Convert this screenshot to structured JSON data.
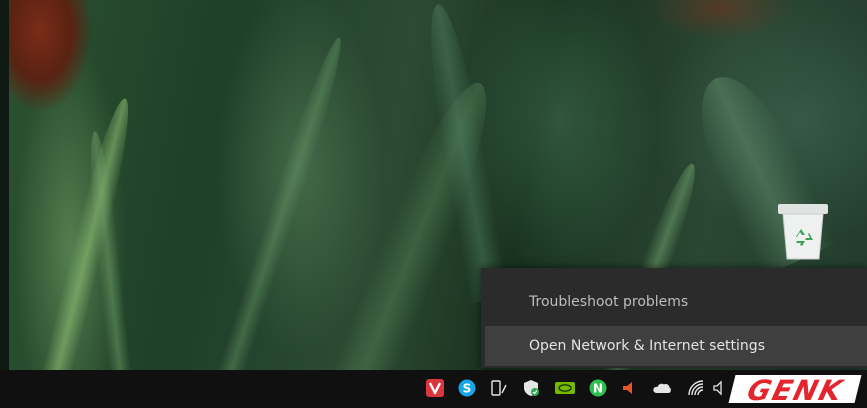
{
  "context_menu": {
    "items": [
      {
        "label": "Troubleshoot problems"
      },
      {
        "label": "Open Network & Internet settings"
      }
    ]
  },
  "desktop": {
    "icons": [
      {
        "icon": "recycle-bin-icon"
      }
    ]
  },
  "taskbar": {
    "tray_icons": [
      {
        "icon": "vivaldi-icon",
        "color": "#d9363e"
      },
      {
        "icon": "skype-icon",
        "color": "#1aa5e6"
      },
      {
        "icon": "tablet-pen-icon",
        "color": "#e6e6e6"
      },
      {
        "icon": "windows-security-icon",
        "color": "#e6e6e6"
      },
      {
        "icon": "nvidia-icon",
        "color": "#76b900"
      },
      {
        "icon": "n-app-icon",
        "color": "#2fbf4b"
      },
      {
        "icon": "speaker-alert-icon",
        "color": "#e8552b"
      },
      {
        "icon": "onedrive-icon",
        "color": "#e6e6e6"
      },
      {
        "icon": "wifi-icon",
        "color": "#e6e6e6"
      },
      {
        "icon": "volume-icon",
        "color": "#e6e6e6"
      }
    ]
  },
  "watermark": {
    "text": "GENK",
    "accent": "#e3262d"
  }
}
